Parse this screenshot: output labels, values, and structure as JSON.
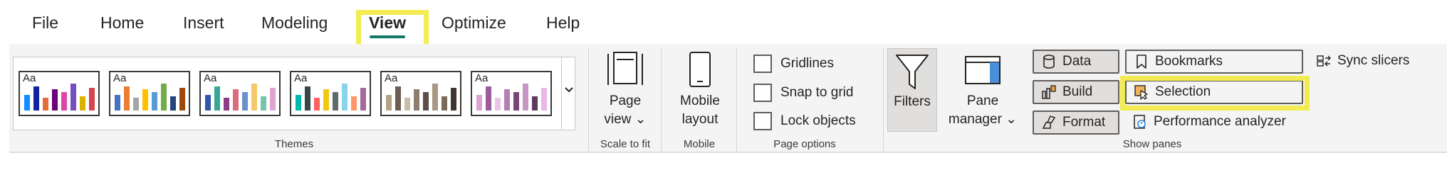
{
  "menu": {
    "tabs": [
      {
        "label": "File"
      },
      {
        "label": "Home"
      },
      {
        "label": "Insert"
      },
      {
        "label": "Modeling"
      },
      {
        "label": "View"
      },
      {
        "label": "Optimize"
      },
      {
        "label": "Help"
      }
    ],
    "active_tab": "View"
  },
  "themes": {
    "group_label": "Themes",
    "swatch_text": "Aa",
    "swatches": [
      {
        "colors": [
          "#118DFF",
          "#12239E",
          "#E66C37",
          "#6B007B",
          "#E044A7",
          "#744EC2",
          "#D9B300",
          "#D64550"
        ]
      },
      {
        "colors": [
          "#4472C4",
          "#ED7D31",
          "#A5A5A5",
          "#FFC000",
          "#5B9BD5",
          "#70AD47",
          "#264478",
          "#9E480E"
        ]
      },
      {
        "colors": [
          "#3257A8",
          "#37A794",
          "#8B3D88",
          "#DD6B7F",
          "#6B91C9",
          "#F5C869",
          "#77C4A8",
          "#DEA6CF"
        ]
      },
      {
        "colors": [
          "#01B8AA",
          "#374649",
          "#FD625E",
          "#F2C80F",
          "#5F6B6D",
          "#8AD4EB",
          "#FE9666",
          "#A66999"
        ]
      },
      {
        "colors": [
          "#B4A285",
          "#6B5E55",
          "#C9BDA9",
          "#8F7E6E",
          "#5C4F47",
          "#A89884",
          "#7A6A5C",
          "#3F3631"
        ]
      },
      {
        "colors": [
          "#D9A3D7",
          "#9C5B9A",
          "#E8C6E7",
          "#B67FB4",
          "#7A4478",
          "#C896C6",
          "#5F3A5E",
          "#EAB8E8"
        ]
      }
    ]
  },
  "scale_to_fit": {
    "group_label": "Scale to fit",
    "page_view": {
      "line1": "Page",
      "line2": "view ⌄"
    }
  },
  "mobile": {
    "group_label": "Mobile",
    "mobile_layout": {
      "line1": "Mobile",
      "line2": "layout"
    }
  },
  "page_options": {
    "group_label": "Page options",
    "checkboxes": [
      {
        "label": "Gridlines",
        "checked": false
      },
      {
        "label": "Snap to grid",
        "checked": false
      },
      {
        "label": "Lock objects",
        "checked": false
      }
    ]
  },
  "show_panes": {
    "group_label": "Show panes",
    "filters": {
      "label": "Filters"
    },
    "pane_manager": {
      "line1": "Pane",
      "line2": "manager ⌄"
    },
    "data": {
      "label": "Data"
    },
    "build": {
      "label": "Build"
    },
    "format": {
      "label": "Format"
    },
    "bookmarks": {
      "label": "Bookmarks"
    },
    "selection": {
      "label": "Selection"
    },
    "performance": {
      "label": "Performance analyzer"
    },
    "sync_slicers": {
      "label": "Sync slicers"
    }
  },
  "colors": {
    "accent": "#117865",
    "highlight": "#f2ec52"
  }
}
